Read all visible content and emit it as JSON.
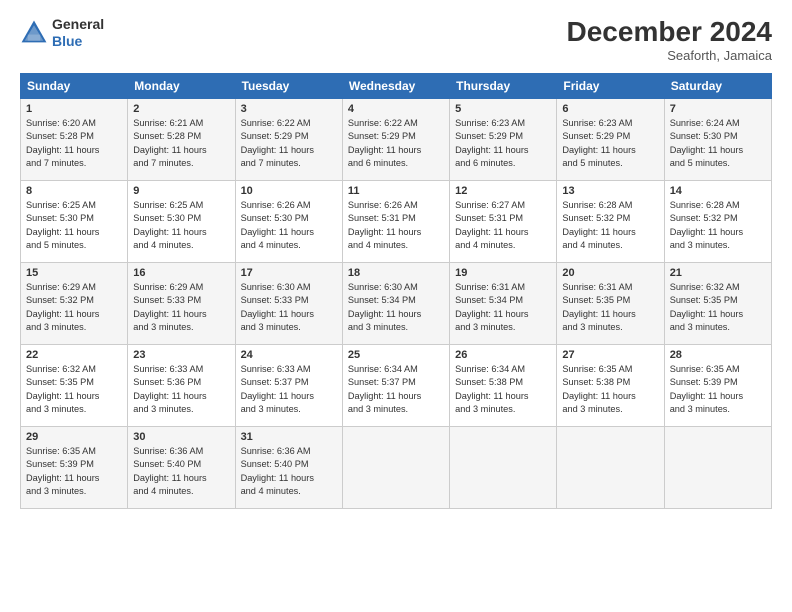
{
  "header": {
    "logo_line1": "General",
    "logo_line2": "Blue",
    "month": "December 2024",
    "location": "Seaforth, Jamaica"
  },
  "days_of_week": [
    "Sunday",
    "Monday",
    "Tuesday",
    "Wednesday",
    "Thursday",
    "Friday",
    "Saturday"
  ],
  "weeks": [
    [
      {
        "day": "1",
        "info": "Sunrise: 6:20 AM\nSunset: 5:28 PM\nDaylight: 11 hours\nand 7 minutes."
      },
      {
        "day": "2",
        "info": "Sunrise: 6:21 AM\nSunset: 5:28 PM\nDaylight: 11 hours\nand 7 minutes."
      },
      {
        "day": "3",
        "info": "Sunrise: 6:22 AM\nSunset: 5:29 PM\nDaylight: 11 hours\nand 7 minutes."
      },
      {
        "day": "4",
        "info": "Sunrise: 6:22 AM\nSunset: 5:29 PM\nDaylight: 11 hours\nand 6 minutes."
      },
      {
        "day": "5",
        "info": "Sunrise: 6:23 AM\nSunset: 5:29 PM\nDaylight: 11 hours\nand 6 minutes."
      },
      {
        "day": "6",
        "info": "Sunrise: 6:23 AM\nSunset: 5:29 PM\nDaylight: 11 hours\nand 5 minutes."
      },
      {
        "day": "7",
        "info": "Sunrise: 6:24 AM\nSunset: 5:30 PM\nDaylight: 11 hours\nand 5 minutes."
      }
    ],
    [
      {
        "day": "8",
        "info": "Sunrise: 6:25 AM\nSunset: 5:30 PM\nDaylight: 11 hours\nand 5 minutes."
      },
      {
        "day": "9",
        "info": "Sunrise: 6:25 AM\nSunset: 5:30 PM\nDaylight: 11 hours\nand 4 minutes."
      },
      {
        "day": "10",
        "info": "Sunrise: 6:26 AM\nSunset: 5:30 PM\nDaylight: 11 hours\nand 4 minutes."
      },
      {
        "day": "11",
        "info": "Sunrise: 6:26 AM\nSunset: 5:31 PM\nDaylight: 11 hours\nand 4 minutes."
      },
      {
        "day": "12",
        "info": "Sunrise: 6:27 AM\nSunset: 5:31 PM\nDaylight: 11 hours\nand 4 minutes."
      },
      {
        "day": "13",
        "info": "Sunrise: 6:28 AM\nSunset: 5:32 PM\nDaylight: 11 hours\nand 4 minutes."
      },
      {
        "day": "14",
        "info": "Sunrise: 6:28 AM\nSunset: 5:32 PM\nDaylight: 11 hours\nand 3 minutes."
      }
    ],
    [
      {
        "day": "15",
        "info": "Sunrise: 6:29 AM\nSunset: 5:32 PM\nDaylight: 11 hours\nand 3 minutes."
      },
      {
        "day": "16",
        "info": "Sunrise: 6:29 AM\nSunset: 5:33 PM\nDaylight: 11 hours\nand 3 minutes."
      },
      {
        "day": "17",
        "info": "Sunrise: 6:30 AM\nSunset: 5:33 PM\nDaylight: 11 hours\nand 3 minutes."
      },
      {
        "day": "18",
        "info": "Sunrise: 6:30 AM\nSunset: 5:34 PM\nDaylight: 11 hours\nand 3 minutes."
      },
      {
        "day": "19",
        "info": "Sunrise: 6:31 AM\nSunset: 5:34 PM\nDaylight: 11 hours\nand 3 minutes."
      },
      {
        "day": "20",
        "info": "Sunrise: 6:31 AM\nSunset: 5:35 PM\nDaylight: 11 hours\nand 3 minutes."
      },
      {
        "day": "21",
        "info": "Sunrise: 6:32 AM\nSunset: 5:35 PM\nDaylight: 11 hours\nand 3 minutes."
      }
    ],
    [
      {
        "day": "22",
        "info": "Sunrise: 6:32 AM\nSunset: 5:35 PM\nDaylight: 11 hours\nand 3 minutes."
      },
      {
        "day": "23",
        "info": "Sunrise: 6:33 AM\nSunset: 5:36 PM\nDaylight: 11 hours\nand 3 minutes."
      },
      {
        "day": "24",
        "info": "Sunrise: 6:33 AM\nSunset: 5:37 PM\nDaylight: 11 hours\nand 3 minutes."
      },
      {
        "day": "25",
        "info": "Sunrise: 6:34 AM\nSunset: 5:37 PM\nDaylight: 11 hours\nand 3 minutes."
      },
      {
        "day": "26",
        "info": "Sunrise: 6:34 AM\nSunset: 5:38 PM\nDaylight: 11 hours\nand 3 minutes."
      },
      {
        "day": "27",
        "info": "Sunrise: 6:35 AM\nSunset: 5:38 PM\nDaylight: 11 hours\nand 3 minutes."
      },
      {
        "day": "28",
        "info": "Sunrise: 6:35 AM\nSunset: 5:39 PM\nDaylight: 11 hours\nand 3 minutes."
      }
    ],
    [
      {
        "day": "29",
        "info": "Sunrise: 6:35 AM\nSunset: 5:39 PM\nDaylight: 11 hours\nand 3 minutes."
      },
      {
        "day": "30",
        "info": "Sunrise: 6:36 AM\nSunset: 5:40 PM\nDaylight: 11 hours\nand 4 minutes."
      },
      {
        "day": "31",
        "info": "Sunrise: 6:36 AM\nSunset: 5:40 PM\nDaylight: 11 hours\nand 4 minutes."
      },
      {
        "day": "",
        "info": ""
      },
      {
        "day": "",
        "info": ""
      },
      {
        "day": "",
        "info": ""
      },
      {
        "day": "",
        "info": ""
      }
    ]
  ]
}
